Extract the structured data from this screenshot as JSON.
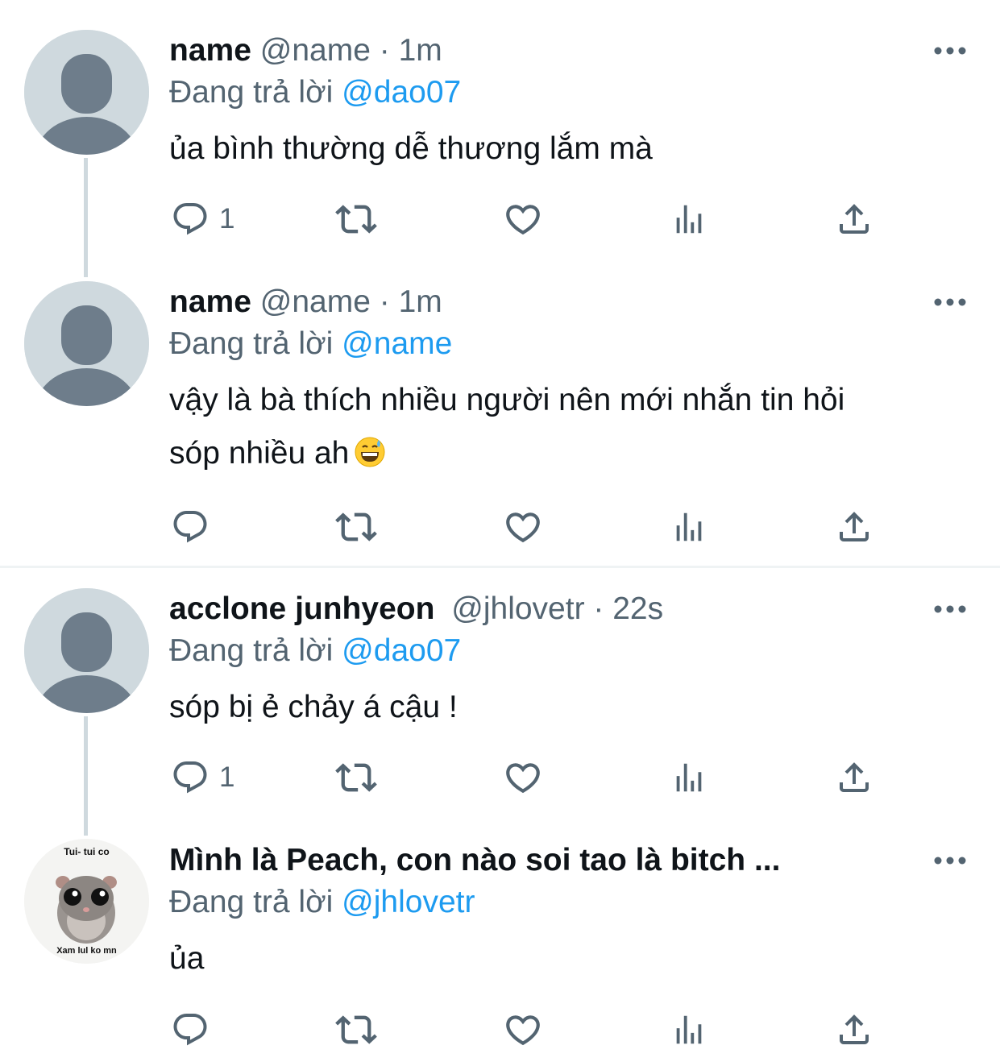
{
  "tweets": [
    {
      "name": "name",
      "handle": "@name",
      "separator": " · ",
      "time": "1m",
      "replying_prefix": "Đang trả lời ",
      "replying_to": "@dao07",
      "text": "ủa bình thường dễ thương lắm mà",
      "reply_count": "1"
    },
    {
      "name": "name",
      "handle": "@name",
      "separator": " · ",
      "time": "1m",
      "replying_prefix": "Đang trả lời ",
      "replying_to": "@name",
      "text_line1": "vậy là bà thích nhiều người nên mới nhắn tin hỏi",
      "text_line2": "sóp nhiều ah",
      "emoji": "grinning-face-with-sweat",
      "reply_count": ""
    },
    {
      "name": "acclone junhyeon",
      "handle": "@jhlovetr",
      "separator": " · ",
      "time": "22s",
      "replying_prefix": "Đang trả lời ",
      "replying_to": "@dao07",
      "text": "sóp bị ẻ chảy á cậu !",
      "reply_count": "1"
    },
    {
      "name": "Mình là Peach, con nào soi tao là bitch ...",
      "replying_prefix": "Đang trả lời ",
      "replying_to": "@jhlovetr",
      "text": "ủa",
      "avatar_top_text": "Tui- tui co",
      "avatar_bottom_text": "Xam lul ko mn",
      "reply_count": ""
    }
  ],
  "icons": {
    "reply": "reply-icon",
    "retweet": "retweet-icon",
    "like": "like-icon",
    "views": "views-icon",
    "share": "share-icon",
    "more": "more-icon"
  },
  "colors": {
    "text": "#0f1419",
    "secondary": "#536471",
    "accent": "#1d9bf0",
    "avatar_bg": "#cfd9de",
    "avatar_fg": "#6e7d8b"
  }
}
